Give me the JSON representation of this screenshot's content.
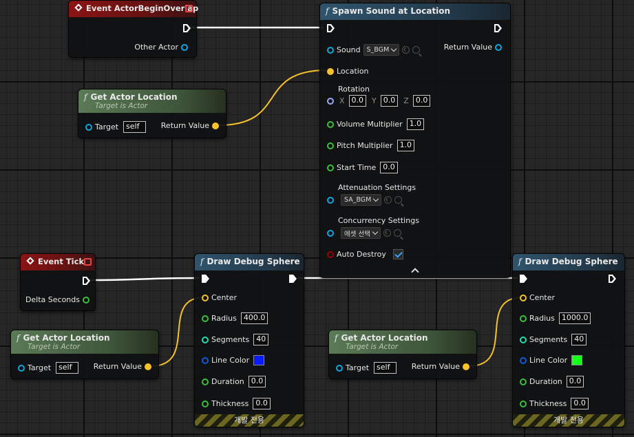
{
  "nodes": {
    "begin_overlap": {
      "title": "Event ActorBeginOverlap",
      "other_actor": "Other Actor"
    },
    "get_loc_1": {
      "title": "Get Actor Location",
      "subtitle": "Target is Actor",
      "target": "Target",
      "target_value": "self",
      "return": "Return Value"
    },
    "spawn_sound": {
      "title": "Spawn Sound at Location",
      "sound": "Sound",
      "sound_value": "S_BGM",
      "return": "Return Value",
      "location": "Location",
      "rotation": "Rotation",
      "x": "X",
      "y": "Y",
      "z": "Z",
      "rot_x": "0.0",
      "rot_y": "0.0",
      "rot_z": "0.0",
      "volume": "Volume Multiplier",
      "volume_value": "1.0",
      "pitch": "Pitch Multiplier",
      "pitch_value": "1.0",
      "start": "Start Time",
      "start_value": "0.0",
      "attenuation": "Attenuation Settings",
      "attenuation_value": "SA_BGM",
      "concurrency": "Concurrency Settings",
      "concurrency_value": "에셋 선택",
      "auto_destroy": "Auto Destroy"
    },
    "event_tick": {
      "title": "Event Tick",
      "delta": "Delta Seconds"
    },
    "get_loc_2": {
      "title": "Get Actor Location",
      "subtitle": "Target is Actor",
      "target": "Target",
      "target_value": "self",
      "return": "Return Value"
    },
    "sphere_1": {
      "title": "Draw Debug Sphere",
      "center": "Center",
      "radius": "Radius",
      "radius_value": "400.0",
      "segments": "Segments",
      "segments_value": "40",
      "line_color": "Line Color",
      "color": "#0a1bff",
      "duration": "Duration",
      "duration_value": "0.0",
      "thickness": "Thickness",
      "thickness_value": "0.0",
      "dev_only": "개발 전용"
    },
    "get_loc_3": {
      "title": "Get Actor Location",
      "subtitle": "Target is Actor",
      "target": "Target",
      "target_value": "self",
      "return": "Return Value"
    },
    "sphere_2": {
      "title": "Draw Debug Sphere",
      "center": "Center",
      "radius": "Radius",
      "radius_value": "1000.0",
      "segments": "Segments",
      "segments_value": "40",
      "line_color": "Line Color",
      "color": "#14ff1a",
      "duration": "Duration",
      "duration_value": "0.0",
      "thickness": "Thickness",
      "thickness_value": "0.0",
      "dev_only": "개발 전용"
    }
  },
  "colors": {
    "event_header": "#8a1414",
    "function_header": "#2f546c",
    "pure_header": "#5b7a56",
    "exec_wire": "#ffffff",
    "vector_wire": "#f7c22e"
  }
}
